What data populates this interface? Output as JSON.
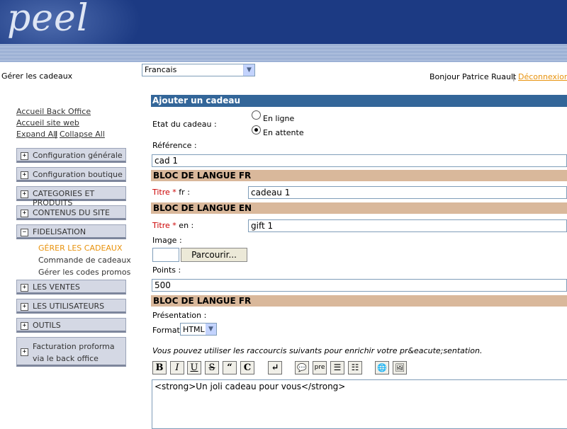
{
  "header": {
    "logo": "peel"
  },
  "topbar": {
    "page_title": "Gérer les cadeaux",
    "language": "Francais",
    "greeting": "Bonjour Patrice Ruault",
    "separator": "|",
    "logout": "Déconnexion"
  },
  "sidebar": {
    "links": {
      "backoffice": "Accueil Back Office",
      "site": "Accueil site web",
      "expand": "Expand All",
      "sep": "|",
      "collapse": "Collapse All"
    },
    "menus": [
      {
        "label": "Configuration générale",
        "sign": "+"
      },
      {
        "label": "Configuration boutique",
        "sign": "+"
      },
      {
        "label": "CATEGORIES ET PRODUITS",
        "sign": "+"
      },
      {
        "label": "CONTENUS DU SITE",
        "sign": "+"
      },
      {
        "label": "FIDELISATION",
        "sign": "−"
      },
      {
        "label": "LES VENTES",
        "sign": "+"
      },
      {
        "label": "LES UTILISATEURS",
        "sign": "+"
      },
      {
        "label": "OUTILS",
        "sign": "+"
      },
      {
        "label": "Facturation proforma via le back office",
        "sign": "+"
      }
    ],
    "submenu": [
      "GÉRER LES CADEAUX",
      "Commande de cadeaux",
      "Gérer les codes promos"
    ],
    "active_color": "#e8920c"
  },
  "form": {
    "title": "Ajouter un cadeau",
    "status_label": "Etat du cadeau :",
    "status_online": "En ligne",
    "status_pending": "En attente",
    "reference_label": "Référence :",
    "reference_value": "cad 1",
    "bloc_fr": "BLOC DE LANGUE FR",
    "title_fr_label": "Titre",
    "title_fr_suffix": " fr :",
    "title_fr_value": "cadeau 1",
    "bloc_en": "BLOC DE LANGUE EN",
    "title_en_label": "Titre",
    "title_en_suffix": " en :",
    "title_en_value": "gift 1",
    "required_mark": " *",
    "image_label": "Image :",
    "browse": "Parcourir...",
    "points_label": "Points :",
    "points_value": "500",
    "bloc_fr2": "BLOC DE LANGUE FR",
    "presentation_label": "Présentation :",
    "format_label": "Format",
    "format_value": "HTML",
    "hint": "Vous pouvez utiliser les raccourcis suivants pour enrichir votre pr&eacute;sentation.",
    "toolbar": {
      "bold": "B",
      "italic": "I",
      "underline": "U",
      "strike": "S",
      "quote": "“",
      "code": "C",
      "br": "↵",
      "comment": "💬",
      "pre": "pre",
      "ul": "☰",
      "ol": "☷",
      "link": "🌐",
      "img": "🖼"
    },
    "editor_value": "<strong>Un joli cadeau pour vous</strong>"
  },
  "colors": {
    "header": "#1c3a83",
    "form_title": "#336699",
    "bloc": "#d9b89b"
  }
}
